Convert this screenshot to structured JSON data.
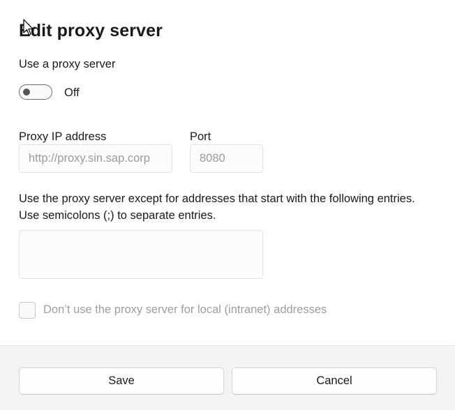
{
  "dialog": {
    "title": "Edit proxy server"
  },
  "proxy_toggle": {
    "label": "Use a proxy server",
    "state_text": "Off",
    "checked": false
  },
  "proxy_ip": {
    "label": "Proxy IP address",
    "placeholder": "http://proxy.sin.sap.corp"
  },
  "port": {
    "label": "Port",
    "placeholder": "8080"
  },
  "exceptions": {
    "description_line1": "Use the proxy server except for addresses that start with the following entries.",
    "description_line2": "Use semicolons (;) to separate entries.",
    "value": ""
  },
  "local_bypass": {
    "label": "Don’t use the proxy server for local (intranet) addresses",
    "checked": false
  },
  "footer": {
    "save_label": "Save",
    "cancel_label": "Cancel"
  },
  "icons": {
    "cursor": "mouse-pointer-icon"
  }
}
